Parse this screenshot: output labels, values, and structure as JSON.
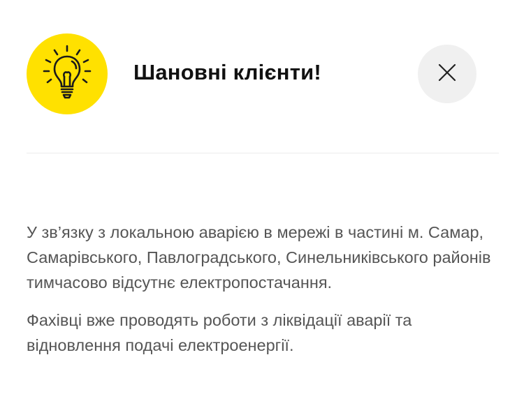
{
  "dialog": {
    "title": "Шановні клієнти!",
    "icon": "lightbulb-icon",
    "close_icon": "close-icon",
    "accent_color": "#ffe100",
    "paragraphs": [
      "У зв’язку з локальною аварією в мережі в частині м. Самар, Самарівського, Павлоградського, Синельниківського районів тимчасово відсутнє електропостачання.",
      "Фахівці вже проводять роботи з ліквідації аварії та відновлення подачі електроенергії."
    ]
  }
}
